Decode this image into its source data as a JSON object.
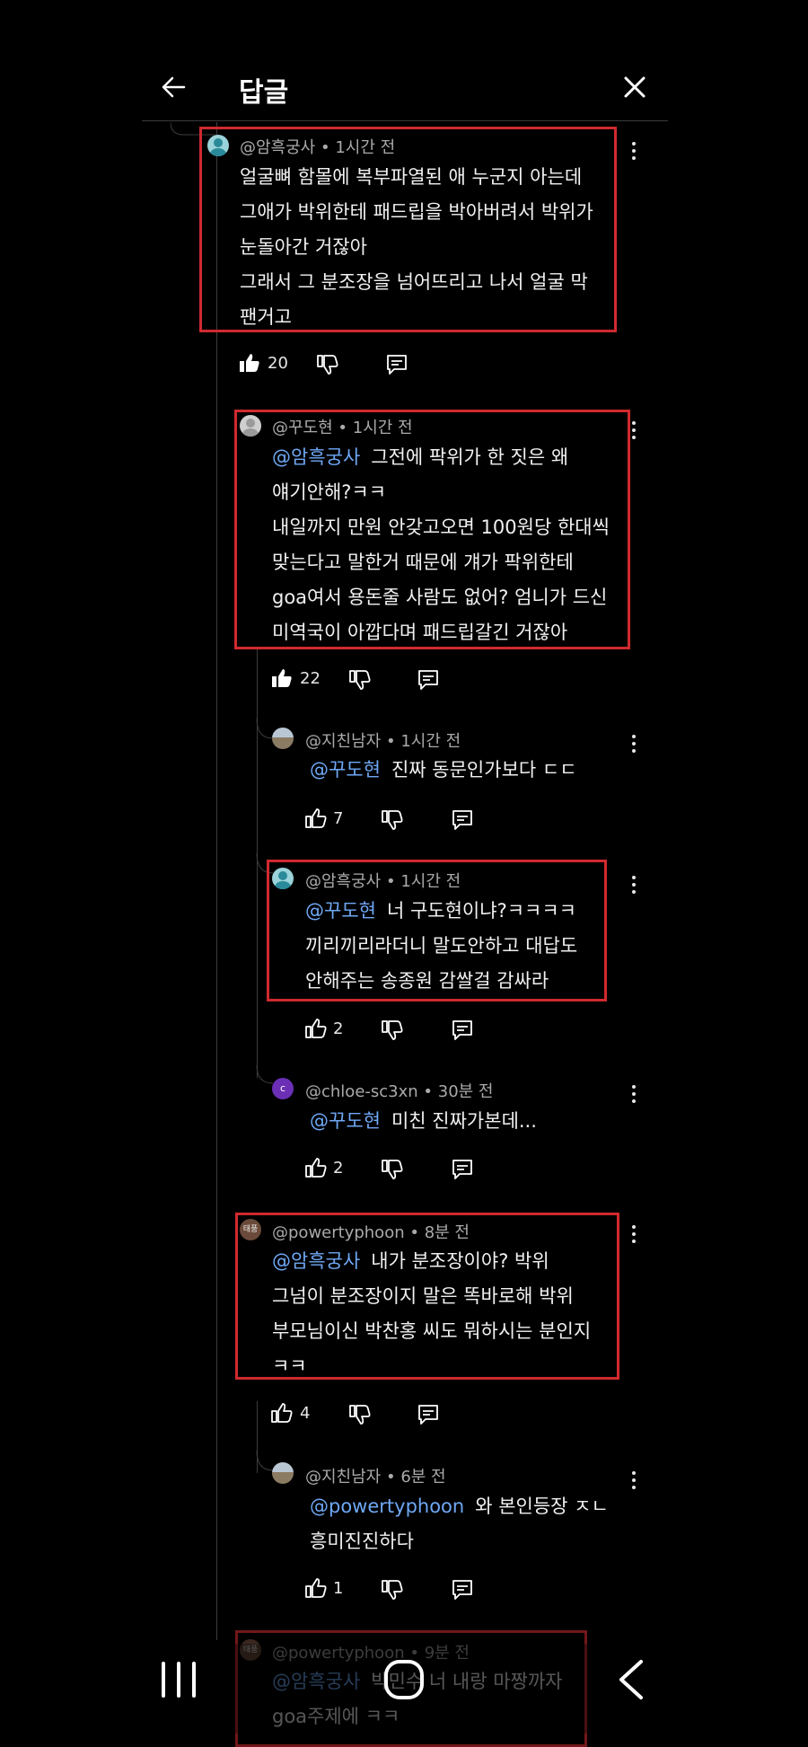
{
  "header": {
    "title": "답글"
  },
  "comments": [
    {
      "handle": "@암흑궁사",
      "time": "1시간 전",
      "avatar": "teal-person",
      "mention": "",
      "lines": [
        "얼굴뼈 함몰에 복부파열된 애 누군지 아는데",
        "그애가 박위한테 패드립을 박아버려서 박위가",
        "눈돌아간 거잖아",
        "그래서 그 분조장을 넘어뜨리고 나서 얼굴 막",
        "팬거고"
      ],
      "likes": "20",
      "liked": true
    },
    {
      "handle": "@꾸도현",
      "time": "1시간 전",
      "avatar": "gray-person",
      "mention": "@암흑궁사",
      "lines": [
        "그전에 팍위가 한 짓은 왜",
        "얘기안해?ㅋㅋ",
        "내일까지 만원 안갖고오면 100원당 한대씩",
        "맞는다고 말한거 때문에 걔가 팍위한테",
        "goa여서 용돈줄 사람도 없어? 엄니가 드신",
        "미역국이 아깝다며 패드립갈긴 거잖아"
      ],
      "likes": "22",
      "liked": true
    },
    {
      "handle": "@지친남자",
      "time": "1시간 전",
      "avatar": "landscape",
      "mention": "@꾸도현",
      "lines": [
        "진짜 동문인가보다 ㄷㄷ"
      ],
      "likes": "7",
      "liked": false
    },
    {
      "handle": "@암흑궁사",
      "time": "1시간 전",
      "avatar": "teal-person",
      "mention": "@꾸도현",
      "lines": [
        "너 구도현이냐?ㅋㅋㅋㅋ",
        "끼리끼리라더니 말도안하고 대답도",
        "안해주는 송종원 감쌀걸 감싸라"
      ],
      "likes": "2",
      "liked": false
    },
    {
      "handle": "@chloe-sc3xn",
      "time": "30분 전",
      "avatar": "purple-c",
      "avatar_letter": "c",
      "mention": "@꾸도현",
      "lines": [
        "미친 진짜가본데..."
      ],
      "likes": "2",
      "liked": false
    },
    {
      "handle": "@powertyphoon",
      "time": "8분 전",
      "avatar": "brown-badge",
      "avatar_letter": "태풍",
      "mention": "@암흑궁사",
      "lines": [
        "내가 분조장이야? 박위",
        "그넘이 분조장이지 말은 똑바로해 박위",
        "부모님이신 박찬홍 씨도 뭐하시는 분인지",
        "ㅋㅋ"
      ],
      "likes": "4",
      "liked": false
    },
    {
      "handle": "@지친남자",
      "time": "6분 전",
      "avatar": "landscape",
      "mention": "@powertyphoon",
      "lines": [
        "와 본인등장 ㅈㄴ",
        "흥미진진하다"
      ],
      "likes": "1",
      "liked": false
    },
    {
      "handle": "@powertyphoon",
      "time": "9분 전",
      "avatar": "brown-badge",
      "avatar_letter": "태풍",
      "mention": "@암흑궁사",
      "lines": [
        "박민수 너 내랑 마짱까자",
        "goa주제에 ㅋㅋ"
      ],
      "likes": "",
      "liked": false
    }
  ],
  "colors": {
    "mention": "#6fa8f5",
    "highlight_box": "#d02a2f",
    "background": "#000000"
  },
  "icons": [
    "back-arrow-icon",
    "close-icon",
    "thumb-up-icon",
    "thumb-down-icon",
    "reply-icon",
    "more-vert-icon",
    "recents-icon",
    "home-icon",
    "nav-back-icon"
  ]
}
